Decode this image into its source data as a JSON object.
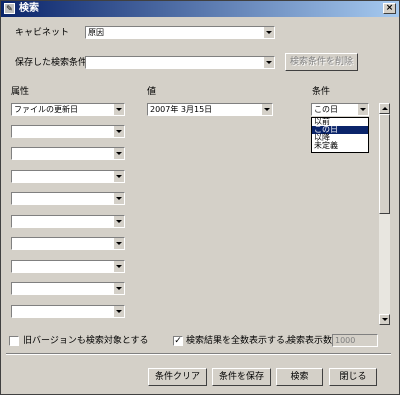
{
  "title": "検索",
  "close_glyph": "×",
  "cabinet": {
    "label": "キャビネット",
    "value": "原因"
  },
  "saved": {
    "label": "保存した検索条件",
    "value": "",
    "delete_button": "検索条件を削除"
  },
  "headers": {
    "attribute": "属性",
    "value": "値",
    "condition": "条件"
  },
  "rows": [
    {
      "attribute": "ファイルの更新日",
      "value": "2007年  3月15日",
      "condition": "この日"
    },
    {
      "attribute": ""
    },
    {
      "attribute": ""
    },
    {
      "attribute": ""
    },
    {
      "attribute": ""
    },
    {
      "attribute": ""
    },
    {
      "attribute": ""
    },
    {
      "attribute": ""
    },
    {
      "attribute": ""
    },
    {
      "attribute": ""
    }
  ],
  "condition_options": [
    "以前",
    "この日",
    "以降",
    "未定義"
  ],
  "condition_selected_index": 1,
  "old_version_checkbox": {
    "label": "旧バージョンも検索対象とする",
    "checked": false
  },
  "show_all_checkbox": {
    "label": "検索結果を全数表示する。",
    "checked": true,
    "check_glyph": "✓"
  },
  "display_count": {
    "label": "検索表示数",
    "value": "1000"
  },
  "buttons": {
    "clear": "条件クリア",
    "save": "条件を保存",
    "search": "検索",
    "close": "閉じる"
  }
}
